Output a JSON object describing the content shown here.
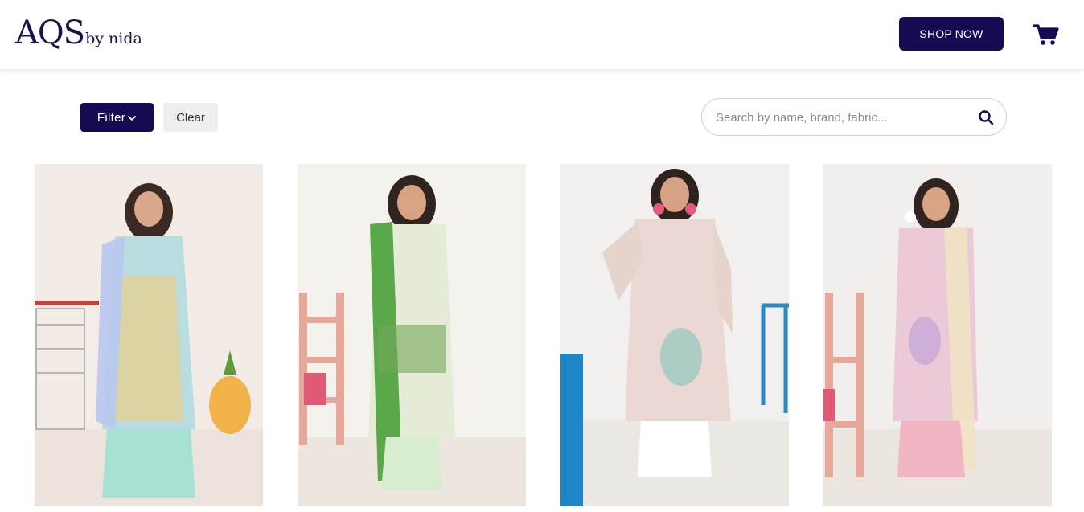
{
  "header": {
    "logo_main": "AQS",
    "logo_sub": "by nida",
    "shop_now_label": "SHOP NOW",
    "cart_icon": "cart-icon"
  },
  "toolbar": {
    "filter_label": "Filter",
    "clear_label": "Clear"
  },
  "search": {
    "placeholder": "Search by name, brand, fabric...",
    "value": ""
  },
  "products": [
    {
      "image": "product-image-1",
      "background": "#f3ece6",
      "outfit": "#b8dce0",
      "accent": "#f2b24a"
    },
    {
      "image": "product-image-2",
      "background": "#f5f1ec",
      "outfit": "#e4ecd8",
      "accent": "#5ba84a"
    },
    {
      "image": "product-image-3",
      "background": "#f1f0ee",
      "outfit": "#ecd8d2",
      "accent": "#9fc9c3"
    },
    {
      "image": "product-image-4",
      "background": "#f2eeeb",
      "outfit": "#ecc9d6",
      "accent": "#c8a8d8"
    }
  ],
  "colors": {
    "brand": "#150b52",
    "clear_bg": "#eeeeee"
  }
}
